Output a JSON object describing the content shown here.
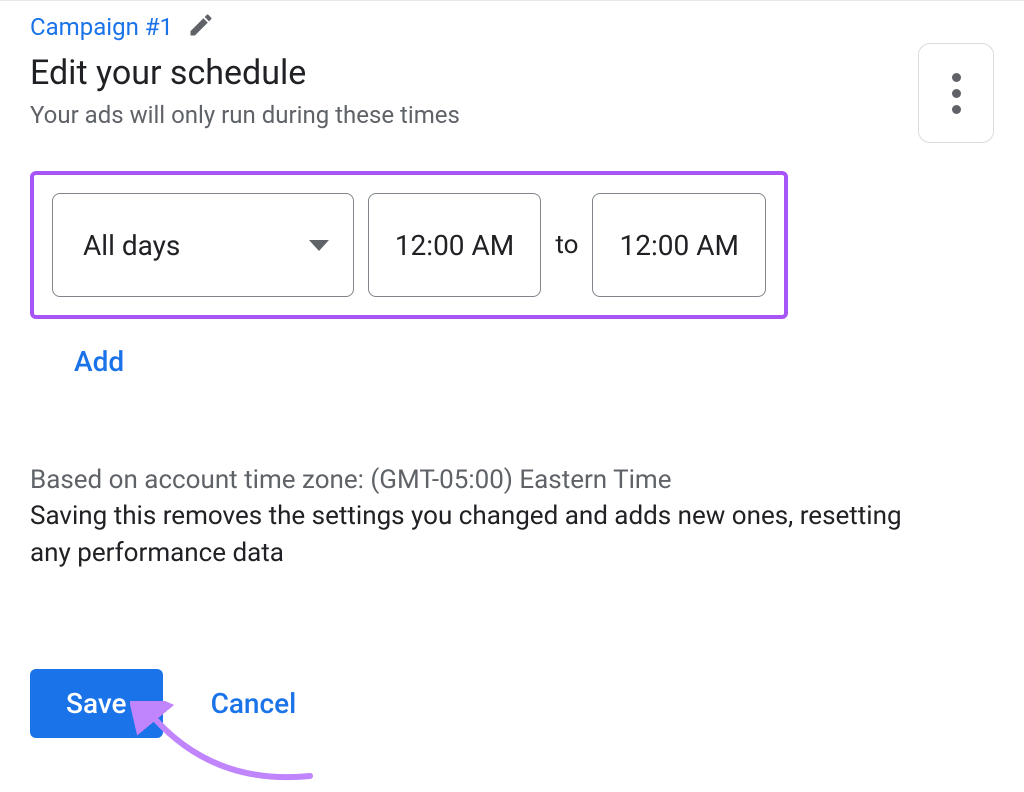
{
  "header": {
    "campaign_name": "Campaign #1",
    "title": "Edit your schedule",
    "subtitle": "Your ads will only run during these times"
  },
  "schedule": {
    "days_label": "All days",
    "start_time": "12:00 AM",
    "to_label": "to",
    "end_time": "12:00 AM",
    "add_label": "Add"
  },
  "notes": {
    "timezone": "Based on account time zone: (GMT-05:00) Eastern Time",
    "warning": "Saving this removes the settings you changed and adds new ones, resetting any performance data"
  },
  "actions": {
    "save_label": "Save",
    "cancel_label": "Cancel"
  }
}
